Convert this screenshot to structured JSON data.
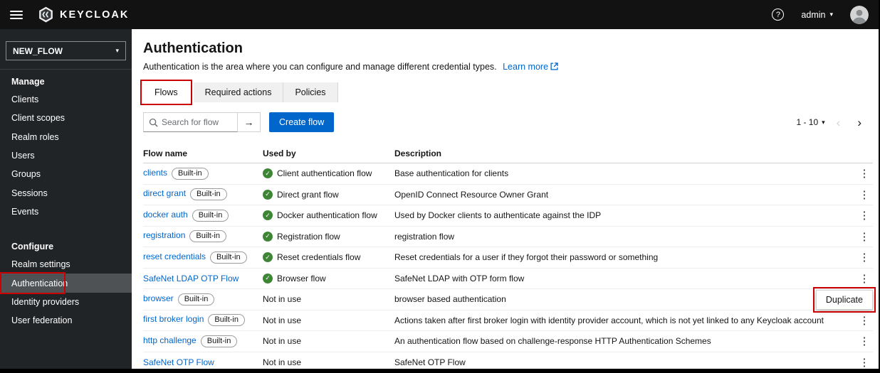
{
  "colors": {
    "accent": "#0066cc",
    "annotation": "#cc0000",
    "success_green": "#3e8635",
    "topbar_bg": "#121212",
    "sidebar_bg": "#212427"
  },
  "topbar": {
    "brand": "KEYCLOAK",
    "help_icon": "question-circle-icon",
    "user": "admin"
  },
  "sidebar": {
    "realm": "NEW_FLOW",
    "sections": [
      {
        "header": "Manage",
        "items": [
          "Clients",
          "Client scopes",
          "Realm roles",
          "Users",
          "Groups",
          "Sessions",
          "Events"
        ]
      },
      {
        "header": "Configure",
        "items": [
          "Realm settings",
          "Authentication",
          "Identity providers",
          "User federation"
        ]
      }
    ],
    "selected_item": "Authentication"
  },
  "main": {
    "title": "Authentication",
    "description": "Authentication is the area where you can configure and manage different credential types.",
    "learn_more": "Learn more",
    "tabs": [
      "Flows",
      "Required actions",
      "Policies"
    ],
    "active_tab": "Flows",
    "search_placeholder": "Search for flow",
    "arrow_button": "→",
    "create_button": "Create flow",
    "pagination": {
      "range": "1 - 10",
      "prev": "‹",
      "next": "›"
    },
    "table": {
      "headers": [
        "Flow name",
        "Used by",
        "Description"
      ],
      "builtin_label": "Built-in",
      "rows": [
        {
          "name": "clients",
          "builtin": true,
          "in_use": true,
          "used_by": "Client authentication flow",
          "description": "Base authentication for clients"
        },
        {
          "name": "direct grant",
          "builtin": true,
          "in_use": true,
          "used_by": "Direct grant flow",
          "description": "OpenID Connect Resource Owner Grant"
        },
        {
          "name": "docker auth",
          "builtin": true,
          "in_use": true,
          "used_by": "Docker authentication flow",
          "description": "Used by Docker clients to authenticate against the IDP"
        },
        {
          "name": "registration",
          "builtin": true,
          "in_use": true,
          "used_by": "Registration flow",
          "description": "registration flow"
        },
        {
          "name": "reset credentials",
          "builtin": true,
          "in_use": true,
          "used_by": "Reset credentials flow",
          "description": "Reset credentials for a user if they forgot their password or something"
        },
        {
          "name": "SafeNet LDAP OTP Flow",
          "builtin": false,
          "in_use": true,
          "used_by": "Browser flow",
          "description": "SafeNet LDAP with OTP form flow"
        },
        {
          "name": "browser",
          "builtin": true,
          "in_use": false,
          "used_by": "Not in use",
          "description": "browser based authentication"
        },
        {
          "name": "first broker login",
          "builtin": true,
          "in_use": false,
          "used_by": "Not in use",
          "description": "Actions taken after first broker login with identity provider account, which is not yet linked to any Keycloak account"
        },
        {
          "name": "http challenge",
          "builtin": true,
          "in_use": false,
          "used_by": "Not in use",
          "description": "An authentication flow based on challenge-response HTTP Authentication Schemes"
        },
        {
          "name": "SafeNet OTP Flow",
          "builtin": false,
          "in_use": false,
          "used_by": "Not in use",
          "description": "SafeNet OTP Flow"
        }
      ]
    },
    "context_menu": {
      "items": [
        "Duplicate"
      ],
      "anchored_row": "browser"
    }
  }
}
